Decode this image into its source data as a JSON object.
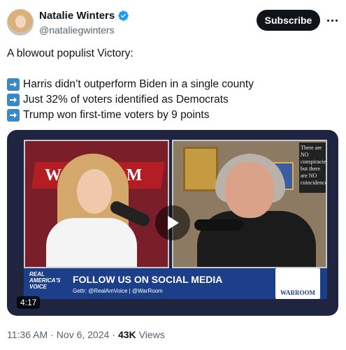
{
  "author": {
    "name": "Natalie Winters",
    "handle": "@nataliegwinters"
  },
  "actions": {
    "subscribe_label": "Subscribe"
  },
  "post": {
    "intro": "A blowout populist Victory:",
    "points": [
      "Harris didn’t outperform Biden in a single county",
      "Just 32% of voters identified as Democrats",
      "Trump won first-time voters by 9 points"
    ]
  },
  "video": {
    "duration": "4:17",
    "banner_left": "WARROOM",
    "lower_logo": "REAL AMERICA'S VOICE",
    "lower_title": "FOLLOW US ON SOCIAL MEDIA",
    "lower_sub": "Gettr: @RealAmVoice | @WarRoom",
    "lower_brand": "WARROOM",
    "quote_text": "There are NO conspiracies but there are NO coincidences"
  },
  "meta": {
    "time": "11:36 AM",
    "separator": "·",
    "date": "Nov 6, 2024",
    "views_count": "43K",
    "views_label": "Views"
  },
  "colors": {
    "verified": "#1d9bf0",
    "arrow": "#3b88c3",
    "text": "#0f1419",
    "muted": "#536471"
  }
}
